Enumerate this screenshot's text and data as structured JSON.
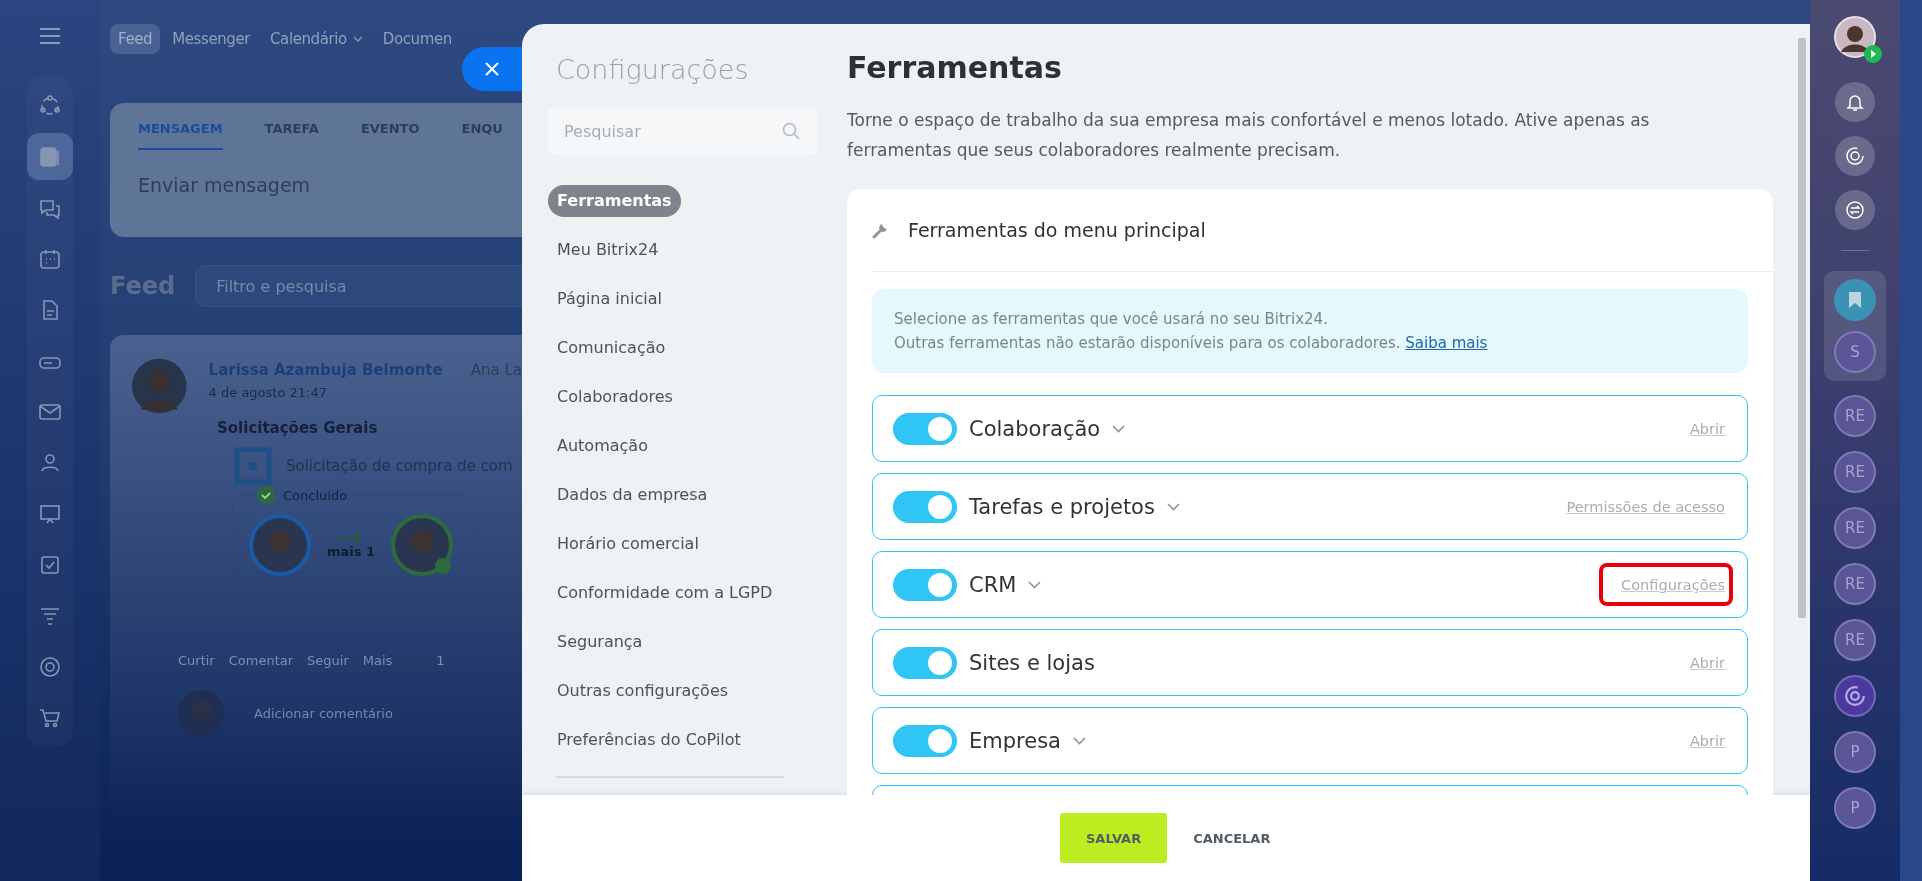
{
  "background": {
    "top_nav": [
      {
        "label": "Feed",
        "selected": true,
        "has_menu": false
      },
      {
        "label": "Messenger",
        "selected": false,
        "has_menu": false
      },
      {
        "label": "Calendário",
        "selected": false,
        "has_menu": true
      },
      {
        "label": "Documen",
        "selected": false,
        "has_menu": false
      }
    ],
    "composer": {
      "tabs": [
        {
          "label": "MENSAGEM",
          "selected": true
        },
        {
          "label": "TAREFA",
          "selected": false
        },
        {
          "label": "EVENTO",
          "selected": false
        },
        {
          "label": "ENQU",
          "selected": false
        }
      ],
      "placeholder": "Enviar mensagem"
    },
    "feed": {
      "title": "Feed",
      "filter_placeholder": "Filtro e pesquisa"
    },
    "post": {
      "author": "Larissa Azambuja Belmonte",
      "recipient": "Ana La",
      "date": "4 de agosto 21:47",
      "title": "Solicitações Gerais",
      "item": "Solicitação de compra de com",
      "status": "Concluído",
      "more": "mais 1",
      "actions": [
        "Curtir",
        "Comentar",
        "Seguir",
        "Mais"
      ],
      "views": "1",
      "comment_placeholder": "Adicionar comentário"
    }
  },
  "settings": {
    "title": "Configurações",
    "search_placeholder": "Pesquisar",
    "menu": [
      {
        "label": "Ferramentas",
        "selected": true
      },
      {
        "label": "Meu Bitrix24",
        "selected": false
      },
      {
        "label": "Página inicial",
        "selected": false
      },
      {
        "label": "Comunicação",
        "selected": false
      },
      {
        "label": "Colaboradores",
        "selected": false
      },
      {
        "label": "Automação",
        "selected": false
      },
      {
        "label": "Dados da empresa",
        "selected": false
      },
      {
        "label": "Horário comercial",
        "selected": false
      },
      {
        "label": "Conformidade com a LGPD",
        "selected": false
      },
      {
        "label": "Segurança",
        "selected": false
      },
      {
        "label": "Outras configurações",
        "selected": false
      },
      {
        "label": "Preferências do CoPilot",
        "selected": false
      }
    ]
  },
  "page": {
    "title": "Ferramentas",
    "description": "Torne o espaço de trabalho da sua empresa mais confortável e menos lotado. Ative apenas as ferramentas que seus colaboradores realmente precisam.",
    "card": {
      "title": "Ferramentas do menu principal",
      "notice": [
        "Selecione as ferramentas que você usará no seu Bitrix24.",
        "Outras ferramentas não estarão disponíveis para os colaboradores."
      ],
      "notice_link": "Saiba mais",
      "tools": [
        {
          "name": "Colaboração",
          "on": true,
          "expandable": true,
          "link": "Abrir",
          "highlighted": false
        },
        {
          "name": "Tarefas e projetos",
          "on": true,
          "expandable": true,
          "link": "Permissões de acesso",
          "highlighted": false
        },
        {
          "name": "CRM",
          "on": true,
          "expandable": true,
          "link": "Configurações",
          "highlighted": true
        },
        {
          "name": "Sites e lojas",
          "on": true,
          "expandable": false,
          "link": "Abrir",
          "highlighted": false
        },
        {
          "name": "Empresa",
          "on": true,
          "expandable": true,
          "link": "Abrir",
          "highlighted": false
        }
      ]
    }
  },
  "footer": {
    "buttons": [
      {
        "label": "SALVAR",
        "kind": "primary"
      },
      {
        "label": "CANCELAR",
        "kind": "link"
      }
    ]
  },
  "right_bar": {
    "chats": [
      {
        "kind": "bookmark",
        "pinned": true
      },
      {
        "kind": "initials",
        "text": "S",
        "pinned": true
      },
      {
        "kind": "initials",
        "text": "RE",
        "pinned": false
      },
      {
        "kind": "initials",
        "text": "RE",
        "pinned": false
      },
      {
        "kind": "initials",
        "text": "RE",
        "pinned": false
      },
      {
        "kind": "initials",
        "text": "RE",
        "pinned": false
      },
      {
        "kind": "initials",
        "text": "RE",
        "pinned": false
      },
      {
        "kind": "copilot",
        "pinned": false
      },
      {
        "kind": "initials",
        "text": "P",
        "pinned": false
      },
      {
        "kind": "initials",
        "text": "P",
        "pinned": false
      }
    ]
  }
}
